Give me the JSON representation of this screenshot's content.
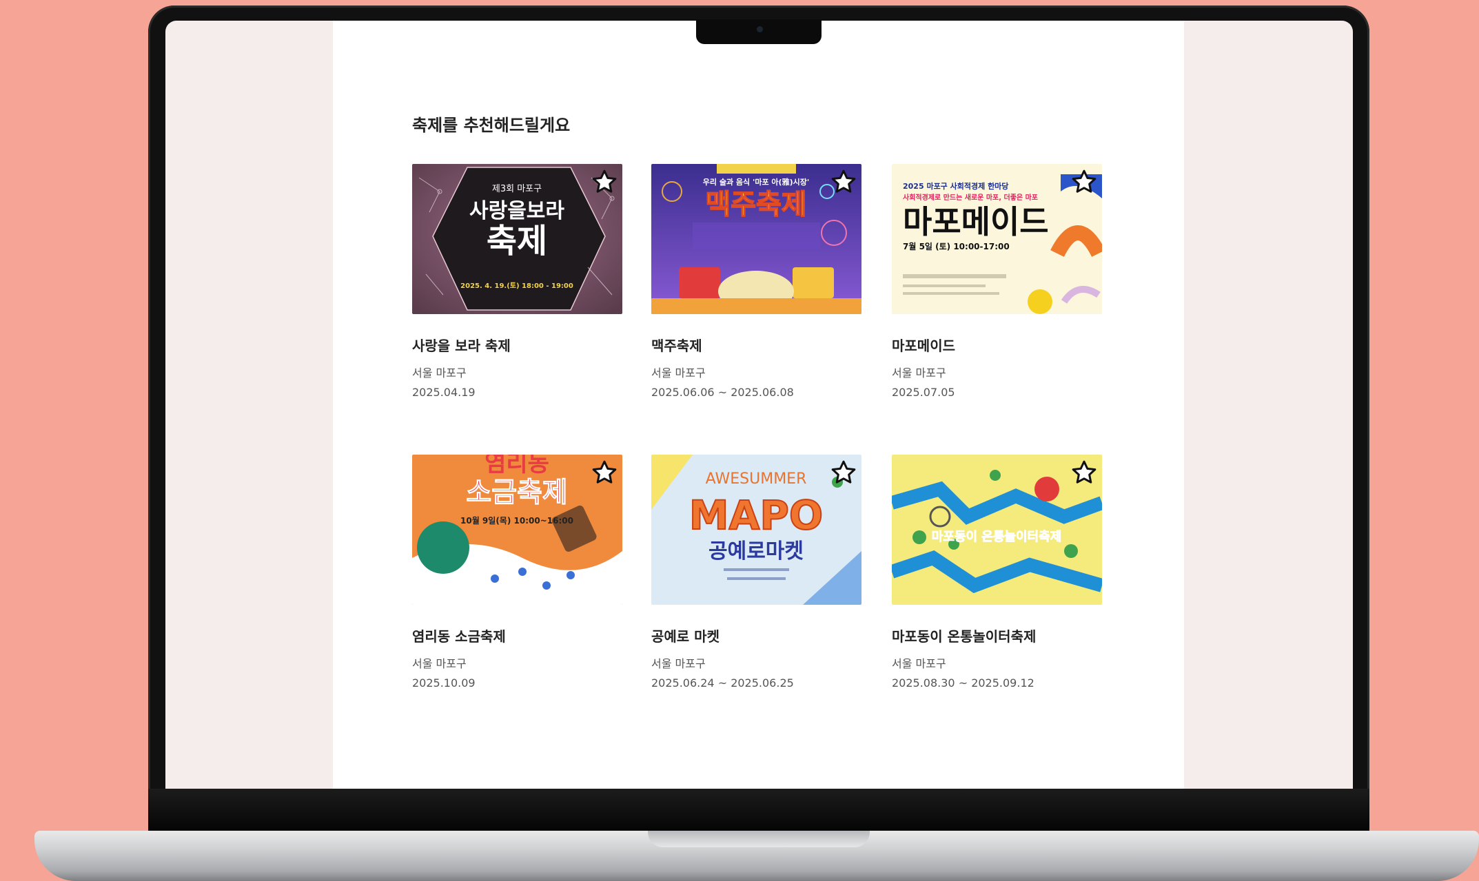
{
  "section": {
    "title": "축제를 추천해드릴게요"
  },
  "festivals": [
    {
      "name": "사랑을 보라 축제",
      "location": "서울 마포구",
      "date": "2025.04.19",
      "poster": {
        "headline_small": "제3회 마포구",
        "headline_main_1": "사랑을보라",
        "headline_main_2": "축제",
        "sub": "2025. 4. 19.(토) 18:00 - 19:00",
        "colors": [
          "#8a5a73",
          "#2a1f24"
        ]
      }
    },
    {
      "name": "맥주축제",
      "location": "서울 마포구",
      "date": "2025.06.06 ~ 2025.06.08",
      "poster": {
        "headline_small": "우리 술과 음식 '마포 아(雅)시장'",
        "headline_main_1": "맥주축제",
        "colors": [
          "#6a4fc7",
          "#f2d24a"
        ]
      }
    },
    {
      "name": "마포메이드",
      "location": "서울 마포구",
      "date": "2025.07.05",
      "poster": {
        "headline_small": "2025 마포구 사회적경제 한마당",
        "headline_tag": "사회적경제로 만드는 새로운 마포, 더좋은 마포",
        "headline_main_1": "마포메이드",
        "sub": "7월 5일 (토) 10:00-17:00",
        "colors": [
          "#fbf6dc",
          "#1d2f8f"
        ]
      }
    },
    {
      "name": "염리동 소금축제",
      "location": "서울 마포구",
      "date": "2025.10.09",
      "poster": {
        "headline_main_1": "염리동",
        "headline_main_2": "소금축제",
        "sub": "10월 9일(목) 10:00~16:00",
        "colors": [
          "#f08a3c",
          "#ffffff"
        ]
      }
    },
    {
      "name": "공예로 마켓",
      "location": "서울 마포구",
      "date": "2025.06.24 ~ 2025.06.25",
      "poster": {
        "headline_small": "AWESUMMER",
        "headline_main_1": "MAPO",
        "headline_main_2": "공예로마켓",
        "colors": [
          "#dbeaf4",
          "#f0762f"
        ]
      }
    },
    {
      "name": "마포동이 온통놀이터축제",
      "location": "서울 마포구",
      "date": "2025.08.30 ~ 2025.09.12",
      "poster": {
        "headline_main_1": "마포동이 온통놀이터축제",
        "colors": [
          "#f5ea7c",
          "#1f8fd6"
        ]
      }
    }
  ],
  "icons": {
    "favorite": "star-outline-icon"
  }
}
